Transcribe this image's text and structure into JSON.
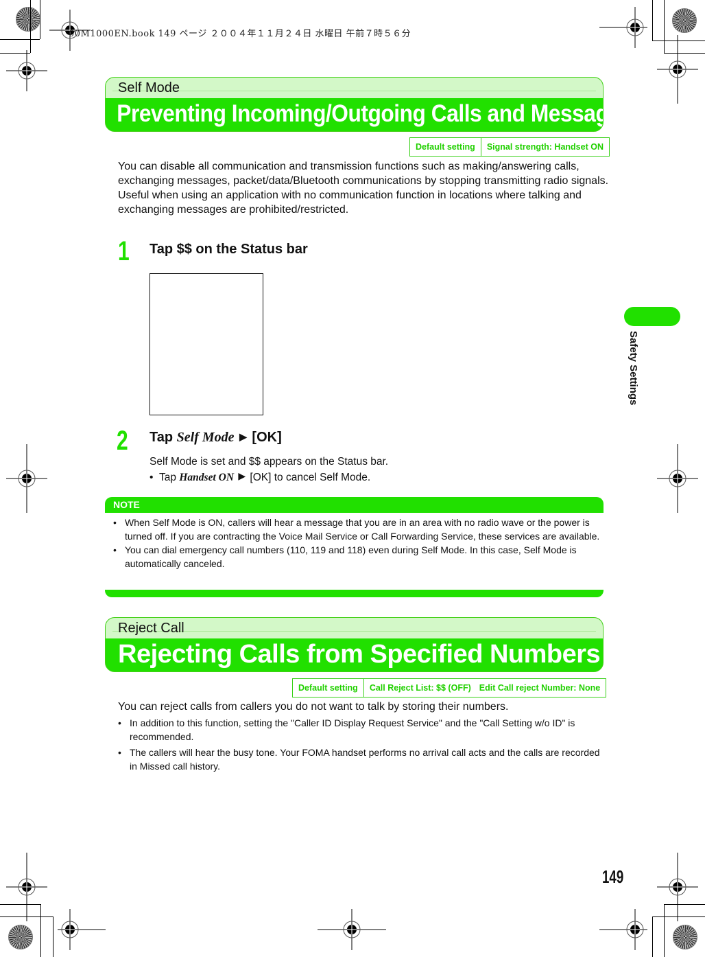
{
  "print_header": "00M1000EN.book  149 ページ  ２００４年１１月２４日  水曜日  午前７時５６分",
  "side_tab": {
    "label": "Safety Settings",
    "color": "#21e000"
  },
  "page_number": "149",
  "section1": {
    "subtitle": "Self Mode",
    "title": "Preventing Incoming/Outgoing Calls and Messages",
    "default_setting": {
      "label": "Default setting",
      "values": [
        "Signal strength: Handset ON"
      ]
    },
    "intro": [
      "You can disable all communication and transmission functions such as making/answering calls, exchanging messages, packet/data/Bluetooth communications by stopping transmitting radio signals.",
      "Useful when using an application with no communication function in locations where talking and exchanging messages are prohibited/restricted."
    ],
    "steps": [
      {
        "number": "1",
        "title": "Tap $$ on the Status bar"
      },
      {
        "number": "2",
        "title_prefix": "Tap ",
        "title_italic": "Self Mode",
        "title_arrow": "▶",
        "title_suffix": " [OK]",
        "body": "Self Mode is set and $$ appears on the Status bar.",
        "bullet_prefix": "Tap ",
        "bullet_italic": "Handset ON",
        "bullet_arrow": "▶",
        "bullet_suffix": " [OK] to cancel Self Mode."
      }
    ],
    "note": {
      "heading": "NOTE",
      "items": [
        "When Self Mode is ON, callers will hear a message that you are in an area with no radio wave or the power is turned off. If you are contracting the Voice Mail Service or Call Forwarding Service, these services are available.",
        "You can dial emergency call numbers (110, 119 and 118) even during Self Mode. In this case, Self Mode is automatically canceled."
      ]
    }
  },
  "section2": {
    "subtitle": "Reject Call",
    "title": "Rejecting Calls from Specified Numbers",
    "default_setting": {
      "label": "Default setting",
      "values": [
        "Call Reject List: $$ (OFF)",
        "Edit Call reject Number: None"
      ]
    },
    "intro": "You can reject calls from callers you do not want to talk by storing their numbers.",
    "bullets": [
      "In addition to this function, setting the \"Caller ID Display Request Service\" and the \"Call Setting w/o ID\" is recommended.",
      "The callers will hear the busy tone. Your FOMA handset performs no arrival call acts and the calls are recorded in Missed call history."
    ]
  },
  "colors": {
    "accent_green": "#21e000",
    "banner_light": "#d3f8c8"
  }
}
